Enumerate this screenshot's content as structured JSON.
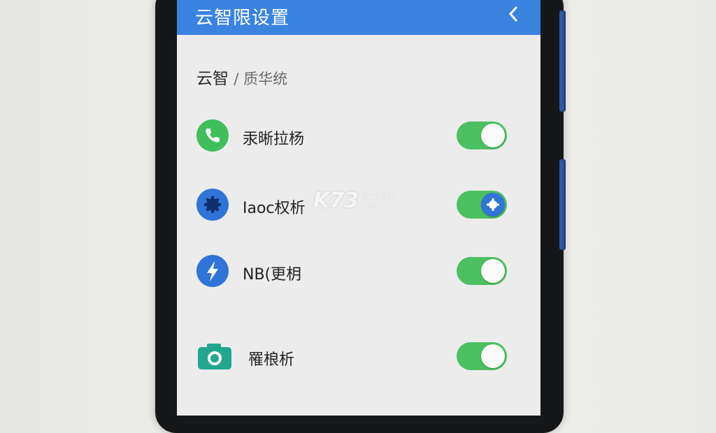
{
  "header": {
    "title": "云智限设置",
    "back_icon": "chevron-left-icon"
  },
  "section": {
    "title": "云智",
    "subtitle": "/ 质华统"
  },
  "settings": [
    {
      "label": "汞晰拉杨",
      "icon": "phone-icon",
      "icon_color": "#3fbf5c",
      "enabled": true
    },
    {
      "label": "Iaoc权析",
      "icon": "gear-icon",
      "icon_color": "#2f74d6",
      "enabled": true
    },
    {
      "label": "NB(更枂",
      "icon": "lightning-icon",
      "icon_color": "#2f74d6",
      "enabled": true
    },
    {
      "label": "罹桹析",
      "icon": "camera-icon",
      "icon_color": "#23a68e",
      "enabled": true
    }
  ],
  "watermark": {
    "logo": "K73",
    "text": "游戏之家",
    "domain": ".com"
  },
  "colors": {
    "appbar": "#3a83e0",
    "toggle_on": "#4cc061",
    "screen_bg": "#ececed"
  }
}
